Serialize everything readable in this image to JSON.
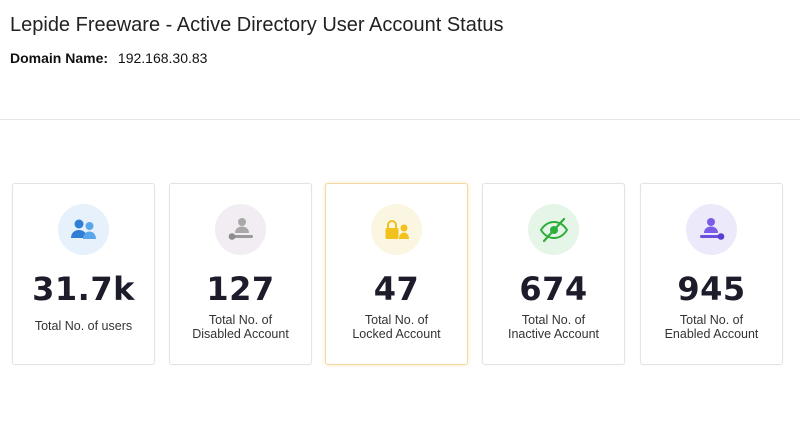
{
  "header": {
    "title": "Lepide Freeware - Active Directory User Account Status",
    "domain_label": "Domain Name:",
    "domain_value": "192.168.30.83"
  },
  "cards": [
    {
      "value": "31.7k",
      "caption": "Total No. of users",
      "icon": "users-icon",
      "color": "#3b8fe0",
      "bg": "#e6f1fb"
    },
    {
      "value": "127",
      "caption": "Total No. of\nDisabled Account",
      "icon": "disabled-user-icon",
      "color": "#9a9a9a",
      "bg": "#f1edf2"
    },
    {
      "value": "47",
      "caption": "Total No. of\nLocked Account",
      "icon": "locked-user-icon",
      "color": "#f2c11d",
      "bg": "#fbf6e2"
    },
    {
      "value": "674",
      "caption": "Total No. of\nInactive Account",
      "icon": "inactive-eye-icon",
      "color": "#2fae3a",
      "bg": "#e5f5e8"
    },
    {
      "value": "945",
      "caption": "Total No. of\nEnabled Account",
      "icon": "enabled-user-icon",
      "color": "#6a4fe0",
      "bg": "#ece9fa"
    }
  ],
  "active_card_index": 2
}
